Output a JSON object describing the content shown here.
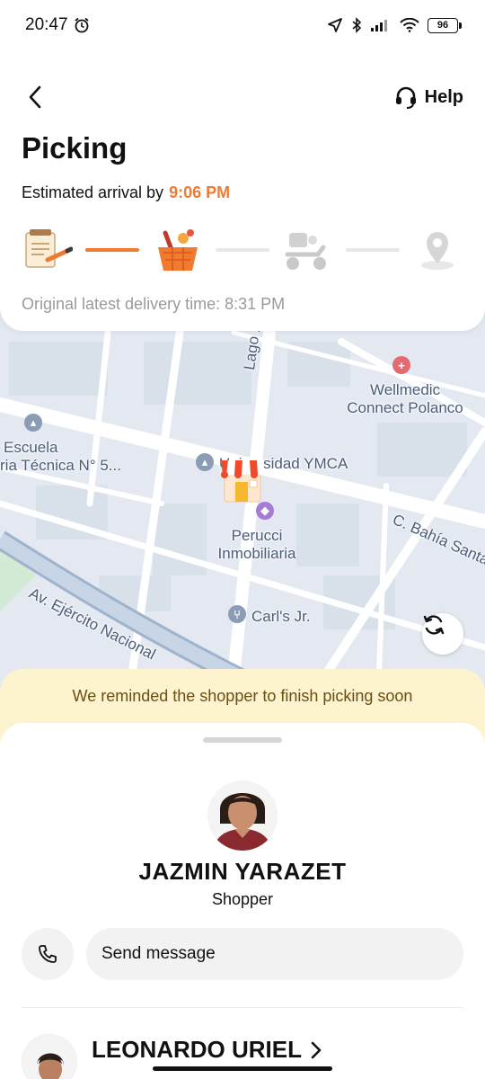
{
  "status_bar": {
    "time": "20:47",
    "battery": "96",
    "icons": [
      "alarm-icon",
      "location-arrow-icon",
      "bluetooth-icon",
      "signal-icon",
      "wifi-icon",
      "battery-icon"
    ]
  },
  "header": {
    "back_icon": "chevron-left-icon",
    "help_icon": "headset-icon",
    "help_label": "Help",
    "title": "Picking",
    "eta_label": "Estimated arrival by",
    "eta_time": "9:06 PM",
    "original_time": "Original latest delivery time: 8:31 PM"
  },
  "progress": {
    "steps": [
      "order-notepad-icon",
      "shopping-basket-icon",
      "delivery-scooter-icon",
      "destination-pin-icon"
    ],
    "current_step": 2,
    "total_steps": 4
  },
  "map": {
    "labels": {
      "lago_xoch": "Lago Xoch",
      "wellmedic_1": "Wellmedic",
      "wellmedic_2": "Connect Polanco",
      "escuela_1": "Escuela",
      "escuela_2": "ria Técnica N° 5...",
      "universidad": "Universidad YMCA",
      "perucci_1": "Perucci",
      "perucci_2": "Inmobiliaria",
      "bahia": "C. Bahía Santa",
      "ejercito": "Av. Ejército Nacional",
      "carls": "Carl's Jr."
    },
    "refresh_icon": "refresh-icon",
    "store_icon": "store-pin-icon"
  },
  "notice": {
    "text": "We reminded the shopper to finish picking soon"
  },
  "shopper": {
    "name": "JAZMIN YARAZET",
    "role": "Shopper",
    "call_icon": "phone-icon",
    "message_placeholder": "Send message"
  },
  "courier": {
    "name": "LEONARDO URIEL",
    "chevron_icon": "chevron-right-icon"
  },
  "colors": {
    "accent": "#f07a30",
    "notice_bg": "#fdf3cf",
    "notice_text": "#6a4f12",
    "map_bg": "#e4e9f1"
  }
}
